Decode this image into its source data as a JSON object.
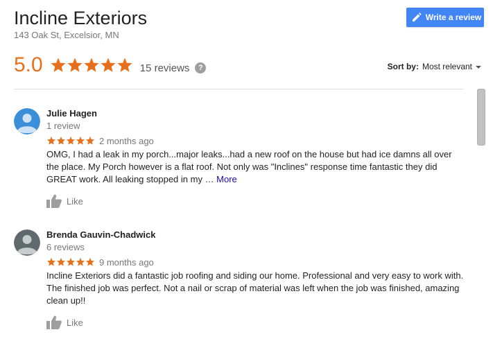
{
  "business": {
    "name": "Incline Exteriors",
    "address": "143 Oak St, Excelsior, MN",
    "rating": "5.0",
    "star_count": 5,
    "reviews_count": "15 reviews"
  },
  "write_review": {
    "label": "Write a review",
    "icon": "pencil-icon"
  },
  "sort": {
    "label": "Sort by:",
    "value": "Most relevant"
  },
  "colors": {
    "accent": "#e7711b",
    "button": "#4285f4",
    "link": "#1a0dab"
  },
  "reviews": [
    {
      "name": "Julie Hagen",
      "count": "1 review",
      "stars": 5,
      "date": "2 months ago",
      "text": "OMG, I had a leak in my porch...major leaks...had a new roof on the house but had ice damns all over the place. My Porch however is a flat roof. Not only was \"Inclines\" response time fantastic they did GREAT work. All leaking stopped in my … ",
      "more": "More",
      "like": "Like",
      "avatar_color": "#3b8fd9"
    },
    {
      "name": "Brenda Gauvin-Chadwick",
      "count": "6 reviews",
      "stars": 5,
      "date": "9 months ago",
      "text": "Incline Exteriors did a fantastic job roofing and siding our home. Professional and very easy to work with. The finished job was perfect. Not a nail or scrap of material was left when the job was finished, amazing clean up!!",
      "more": "",
      "like": "Like",
      "avatar_color": "#5f6a6d"
    }
  ]
}
